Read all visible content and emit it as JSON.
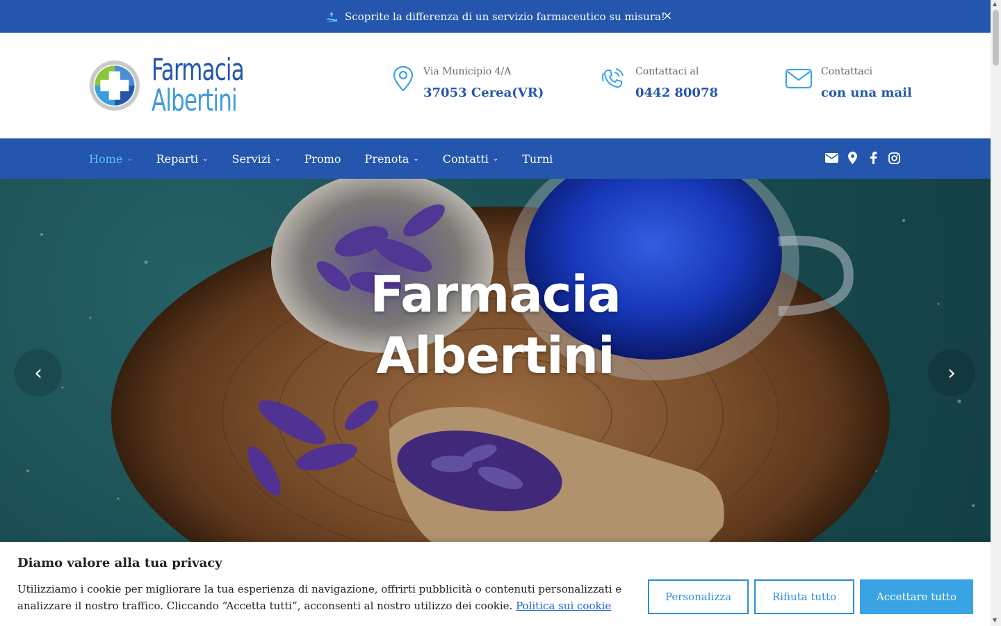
{
  "topbar": {
    "message": "Scoprite la differenza di un servizio farmaceutico su misura!",
    "close_label": "×"
  },
  "logo": {
    "line1": "Farmacia",
    "line2": "Albertini"
  },
  "contacts": [
    {
      "small": "Via Municipio 4/A",
      "big": "37053 Cerea(VR)",
      "icon": "map-pin-icon"
    },
    {
      "small": "Contattaci al",
      "big": "0442 80078",
      "icon": "phone-icon"
    },
    {
      "small": "Contattaci",
      "big": "con una mail",
      "icon": "mail-icon"
    }
  ],
  "nav": {
    "items": [
      {
        "label": "Home",
        "dropdown": true,
        "active": true
      },
      {
        "label": "Reparti",
        "dropdown": true
      },
      {
        "label": "Servizi",
        "dropdown": true
      },
      {
        "label": "Promo",
        "dropdown": false
      },
      {
        "label": "Prenota",
        "dropdown": true
      },
      {
        "label": "Contatti",
        "dropdown": true
      },
      {
        "label": "Turni",
        "dropdown": false
      }
    ],
    "social_icons": [
      "envelope-icon",
      "location-icon",
      "facebook-icon",
      "instagram-icon"
    ]
  },
  "hero": {
    "title_line1": "Farmacia",
    "title_line2": "Albertini",
    "prev_label": "‹",
    "next_label": "›"
  },
  "cookie": {
    "title": "Diamo valore alla tua privacy",
    "text": "Utilizziamo i cookie per migliorare la tua esperienza di navigazione, offrirti pubblicità o contenuti personalizzati e analizzare il nostro traffico. Cliccando “Accetta tutti”, acconsenti al nostro utilizzo dei cookie.",
    "link": "Politica sui cookie",
    "btn_customize": "Personalizza",
    "btn_reject": "Rifiuta tutto",
    "btn_accept": "Accettare tutto"
  },
  "colors": {
    "brand_blue": "#2456ad",
    "accent_light_blue": "#3aa3e3",
    "active_nav": "#5cc2f2"
  }
}
